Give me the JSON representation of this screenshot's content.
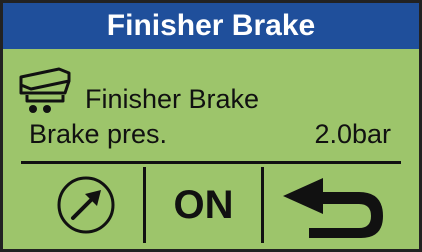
{
  "window": {
    "title": "Finisher Brake"
  },
  "main": {
    "heading_icon": "finisher-brake-icon",
    "heading_label": "Finisher Brake",
    "parameter": {
      "label": "Brake pres.",
      "value": "2.0bar"
    }
  },
  "softkeys": {
    "adjust_icon": "diagonal-arrow-circle-icon",
    "toggle_label": "ON",
    "back_icon": "return-arrow-icon"
  },
  "colors": {
    "screen_background": "#9dc56b",
    "title_bar": "#1f4f9b",
    "title_text": "#ffffff",
    "foreground": "#111111"
  }
}
